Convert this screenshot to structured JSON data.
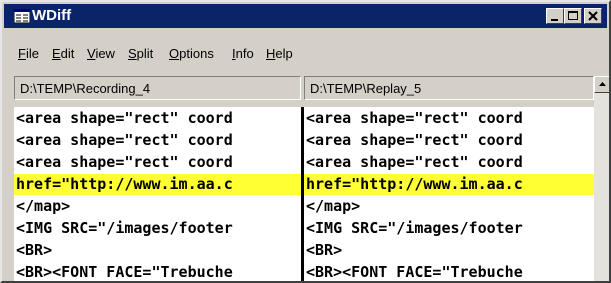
{
  "window": {
    "title": "WDiff",
    "controls": [
      "minimize-icon",
      "maximize-icon",
      "close-icon"
    ]
  },
  "menu": [
    {
      "label": "File",
      "key": "F",
      "rest": "ile"
    },
    {
      "label": "Edit",
      "key": "E",
      "rest": "dit"
    },
    {
      "label": "View",
      "key": "V",
      "rest": "iew"
    },
    {
      "label": "Split",
      "key": "S",
      "rest": "plit"
    },
    {
      "label": "Options",
      "key": "O",
      "rest": "ptions"
    },
    {
      "label": "Info",
      "key": "I",
      "rest": "nfo"
    },
    {
      "label": "Help",
      "key": "H",
      "rest": "elp"
    }
  ],
  "left": {
    "path": "D:\\TEMP\\Recording_4",
    "lines": [
      "<area shape=\"rect\" coord",
      "<area shape=\"rect\" coord",
      "<area shape=\"rect\" coord",
      "href=\"http://www.im.aa.c",
      "</map>",
      "<IMG SRC=\"/images/footer",
      "<BR>",
      "<BR><FONT FACE=\"Trebuche"
    ]
  },
  "right": {
    "path": "D:\\TEMP\\Replay_5",
    "lines": [
      "<area shape=\"rect\" coord",
      "<area shape=\"rect\" coord",
      "<area shape=\"rect\" coord",
      "href=\"http://www.im.aa.c",
      "</map>",
      "<IMG SRC=\"/images/footer",
      "<BR>",
      "<BR><FONT FACE=\"Trebuche"
    ]
  },
  "changed_line_index": 3,
  "colors": {
    "titlebar": "#0a246a",
    "highlight": "#ffff33",
    "chrome": "#d4d0c8"
  }
}
